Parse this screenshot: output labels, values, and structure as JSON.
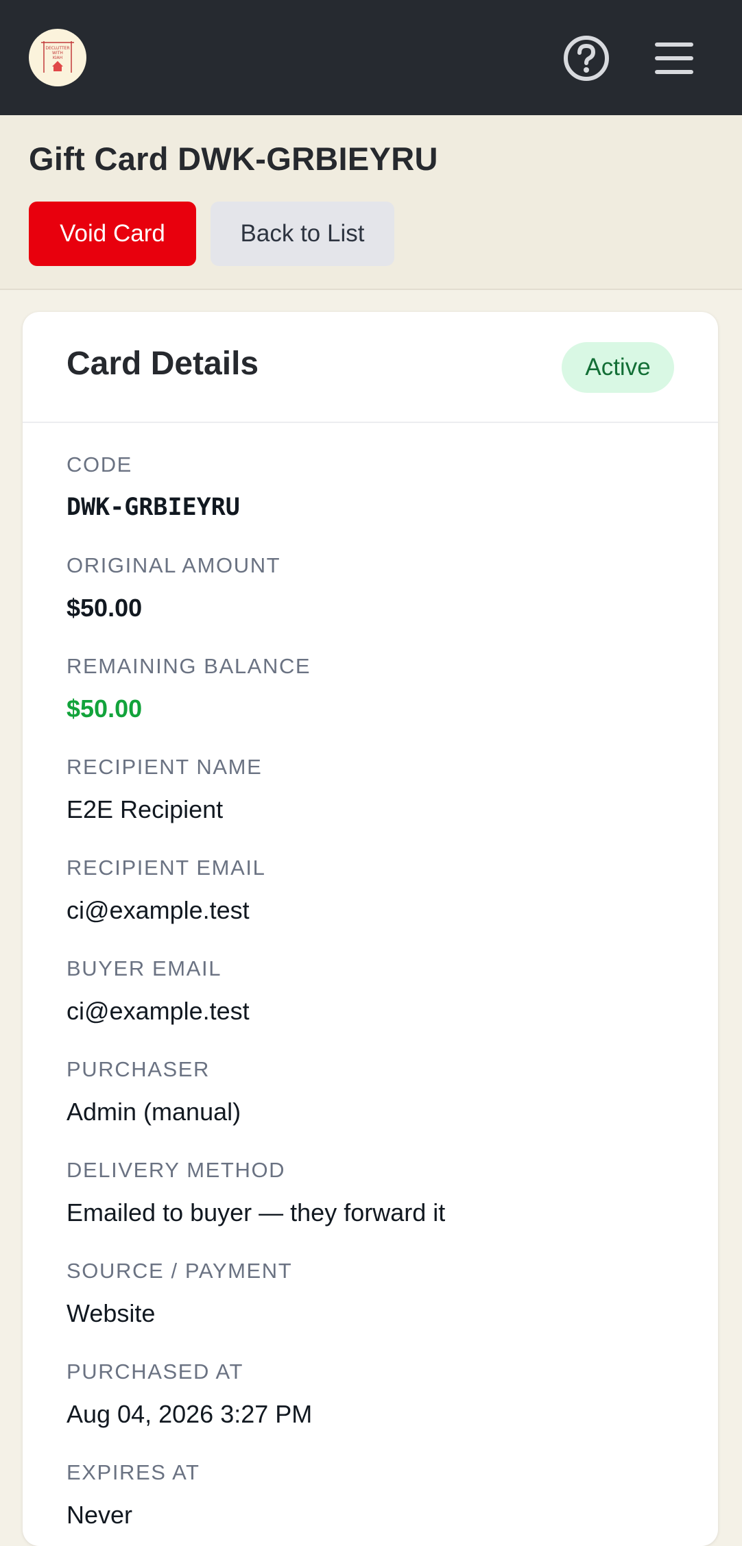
{
  "header": {
    "logo_text": [
      "DECLUTTER",
      "WITH",
      "KIAH"
    ],
    "help_icon": "question-circle-icon",
    "menu_icon": "hamburger-menu-icon"
  },
  "page": {
    "title": "Gift Card DWK-GRBIEYRU",
    "void_button": "Void Card",
    "back_button": "Back to List"
  },
  "card": {
    "title": "Card Details",
    "status": "Active",
    "fields": [
      {
        "label": "Code",
        "value": "DWK-GRBIEYRU"
      },
      {
        "label": "Original Amount",
        "value": "$50.00"
      },
      {
        "label": "Remaining Balance",
        "value": "$50.00"
      },
      {
        "label": "Recipient Name",
        "value": "E2E Recipient"
      },
      {
        "label": "Recipient Email",
        "value": "ci@example.test"
      },
      {
        "label": "Buyer Email",
        "value": "ci@example.test"
      },
      {
        "label": "Purchaser",
        "value": "Admin (manual)"
      },
      {
        "label": "Delivery Method",
        "value": "Emailed to buyer — they forward it"
      },
      {
        "label": "Source / Payment",
        "value": "Website"
      },
      {
        "label": "Purchased At",
        "value": "Aug 04, 2026 3:27 PM"
      },
      {
        "label": "Expires At",
        "value": "Never"
      }
    ]
  },
  "colors": {
    "topbar": "#262a30",
    "void": "#e8000d",
    "balance": "#12a33b",
    "badge_bg": "#d9f8e4",
    "badge_text": "#136f36"
  }
}
